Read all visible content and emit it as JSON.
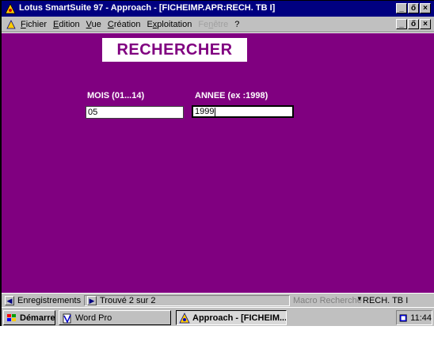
{
  "window": {
    "title": "Lotus SmartSuite 97   -  Approach - [FICHEIMP.APR:RECH. TB I]",
    "minimize": "_",
    "restore": "ő",
    "close": "×"
  },
  "menu": {
    "items": [
      {
        "label": "Fichier",
        "accel": "F"
      },
      {
        "label": "Edition",
        "accel": "E"
      },
      {
        "label": "Vue",
        "accel": "V"
      },
      {
        "label": "Création",
        "accel": "C"
      },
      {
        "label": "Exploitation",
        "accel": "x"
      },
      {
        "label": "Fenêtre",
        "accel": "n",
        "disabled": true
      },
      {
        "label": "?",
        "accel": "?"
      }
    ]
  },
  "form": {
    "title": "RECHERCHER",
    "mois_label": "MOIS (01...14)",
    "mois_value": "05",
    "annee_label": "ANNEE (ex :1998)",
    "annee_value": "1999",
    "background": "#800080"
  },
  "statusbar": {
    "records": "Enregistrements",
    "found": "Trouvé 2 sur 2",
    "macro": "Macro Recherche",
    "view": "RECH. TB I"
  },
  "taskbar": {
    "start": "Démarrer",
    "word_pro": "Word Pro",
    "approach": "Approach - [FICHEIM...",
    "clock": "11:44"
  }
}
